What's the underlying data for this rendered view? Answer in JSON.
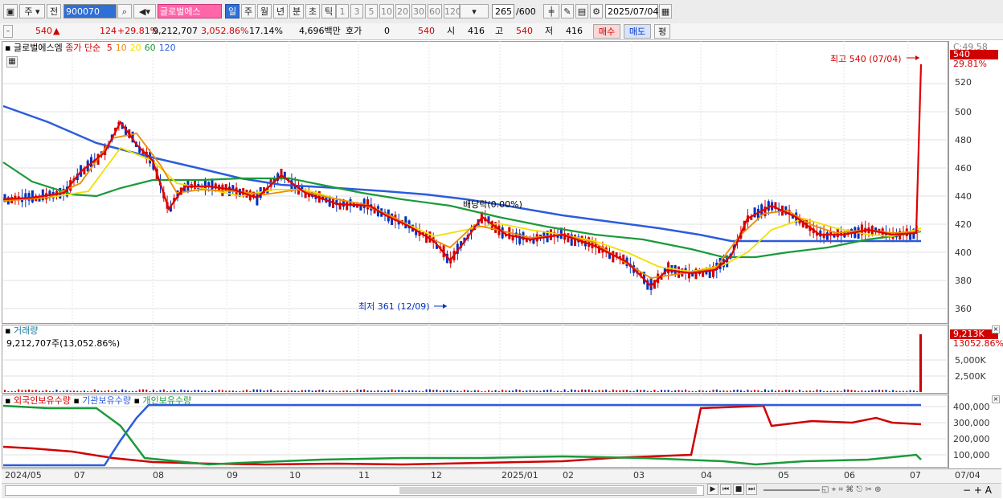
{
  "toolbar": {
    "market_dropdown": "주",
    "prev_button": "전",
    "stock_code": "900070",
    "stock_name": "글로벌에스",
    "period_tabs": [
      "일",
      "주",
      "월",
      "년",
      "분",
      "초",
      "틱"
    ],
    "selected_period": "일",
    "interval_buttons": [
      "1",
      "3",
      "5",
      "10",
      "20",
      "30",
      "60",
      "120"
    ],
    "bars_shown": "265",
    "bars_total": "/600",
    "date": "2025/07/04"
  },
  "quote": {
    "price": "540",
    "change": "124",
    "change_pct": "+29.81%",
    "volume": "9,212,707",
    "volume_pct": "3,052.86%",
    "turnover": "17.14%",
    "amount": "4,696백만",
    "hoga_label": "호가",
    "hoga_value": "0",
    "hoga_price": "540",
    "open_label": "시",
    "open": "416",
    "high_label": "고",
    "high": "540",
    "low_label": "저",
    "low": "416",
    "buy_button": "매수",
    "sell_button": "매도",
    "avg_button": "평"
  },
  "price_panel": {
    "name": "글로벌에스엠",
    "indicator": "종가 단순",
    "ma_periods": [
      "5",
      "10",
      "20",
      "60",
      "120"
    ],
    "ma_colors": [
      "#e00000",
      "#f08a00",
      "#f0e000",
      "#1a9a3a",
      "#2a5cdc"
    ],
    "axis_top_label": "C:49.58",
    "axis_ticks": [
      "520",
      "500",
      "480",
      "460",
      "440",
      "420",
      "400",
      "380",
      "360"
    ],
    "last_price_tag": "540",
    "last_pct_tag": "29.81%",
    "high_annotation": "최고 540 (07/04)",
    "low_annotation": "최저 361 (12/09)",
    "dividend_annotation": "배당락(0.00%)"
  },
  "volume_panel": {
    "title": "거래량",
    "value_text": "9,212,707주(13,052.86%)",
    "tag": "9,213K",
    "tag_pct": "13052.86%",
    "axis_ticks": [
      "5,000K",
      "2,500K"
    ]
  },
  "holding_panel": {
    "series_labels": [
      "외국인보유수량",
      "기관보유수량",
      "개인보유수량"
    ],
    "series_colors": [
      "#d00000",
      "#2a5cdc",
      "#1a9a3a"
    ],
    "axis_ticks": [
      "400,000",
      "300,000",
      "200,000",
      "100,000"
    ]
  },
  "x_axis": {
    "labels": [
      "2024/05",
      "07",
      "08",
      "09",
      "10",
      "11",
      "12",
      "2025/01",
      "02",
      "03",
      "04",
      "05",
      "06",
      "07"
    ],
    "right_label": "07/04"
  }
}
